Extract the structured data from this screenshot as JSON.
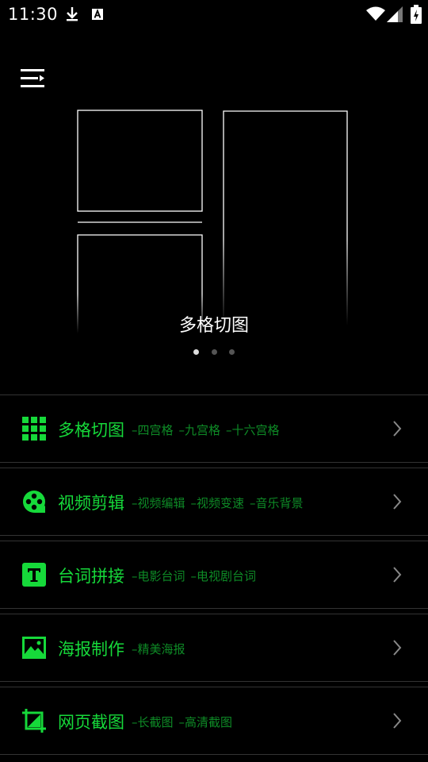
{
  "status_bar": {
    "time": "11:30",
    "icons": [
      "download-icon",
      "a-icon",
      "wifi-icon",
      "signal-icon",
      "battery-icon"
    ]
  },
  "menu": {
    "icon": "menu-icon"
  },
  "banner": {
    "title": "多格切图",
    "page_count": 3,
    "active_page": 1
  },
  "colors": {
    "accent": "#16d93a",
    "accent_dim": "#0e8a26",
    "divider": "#333333",
    "chevron": "#888888",
    "background": "#000000"
  },
  "features": [
    {
      "icon": "grid-icon",
      "title": "多格切图",
      "subs": [
        "–四宫格",
        "–九宫格",
        "–十六宫格"
      ]
    },
    {
      "icon": "film-reel-icon",
      "title": "视频剪辑",
      "subs": [
        "–视频编辑",
        "–视频变速",
        "–音乐背景"
      ]
    },
    {
      "icon": "text-t-icon",
      "title": "台词拼接",
      "subs": [
        "–电影台词",
        "–电视剧台词"
      ]
    },
    {
      "icon": "image-icon",
      "title": "海报制作",
      "subs": [
        "–精美海报"
      ]
    },
    {
      "icon": "crop-icon",
      "title": "网页截图",
      "subs": [
        "–长截图",
        "–高清截图"
      ]
    }
  ]
}
